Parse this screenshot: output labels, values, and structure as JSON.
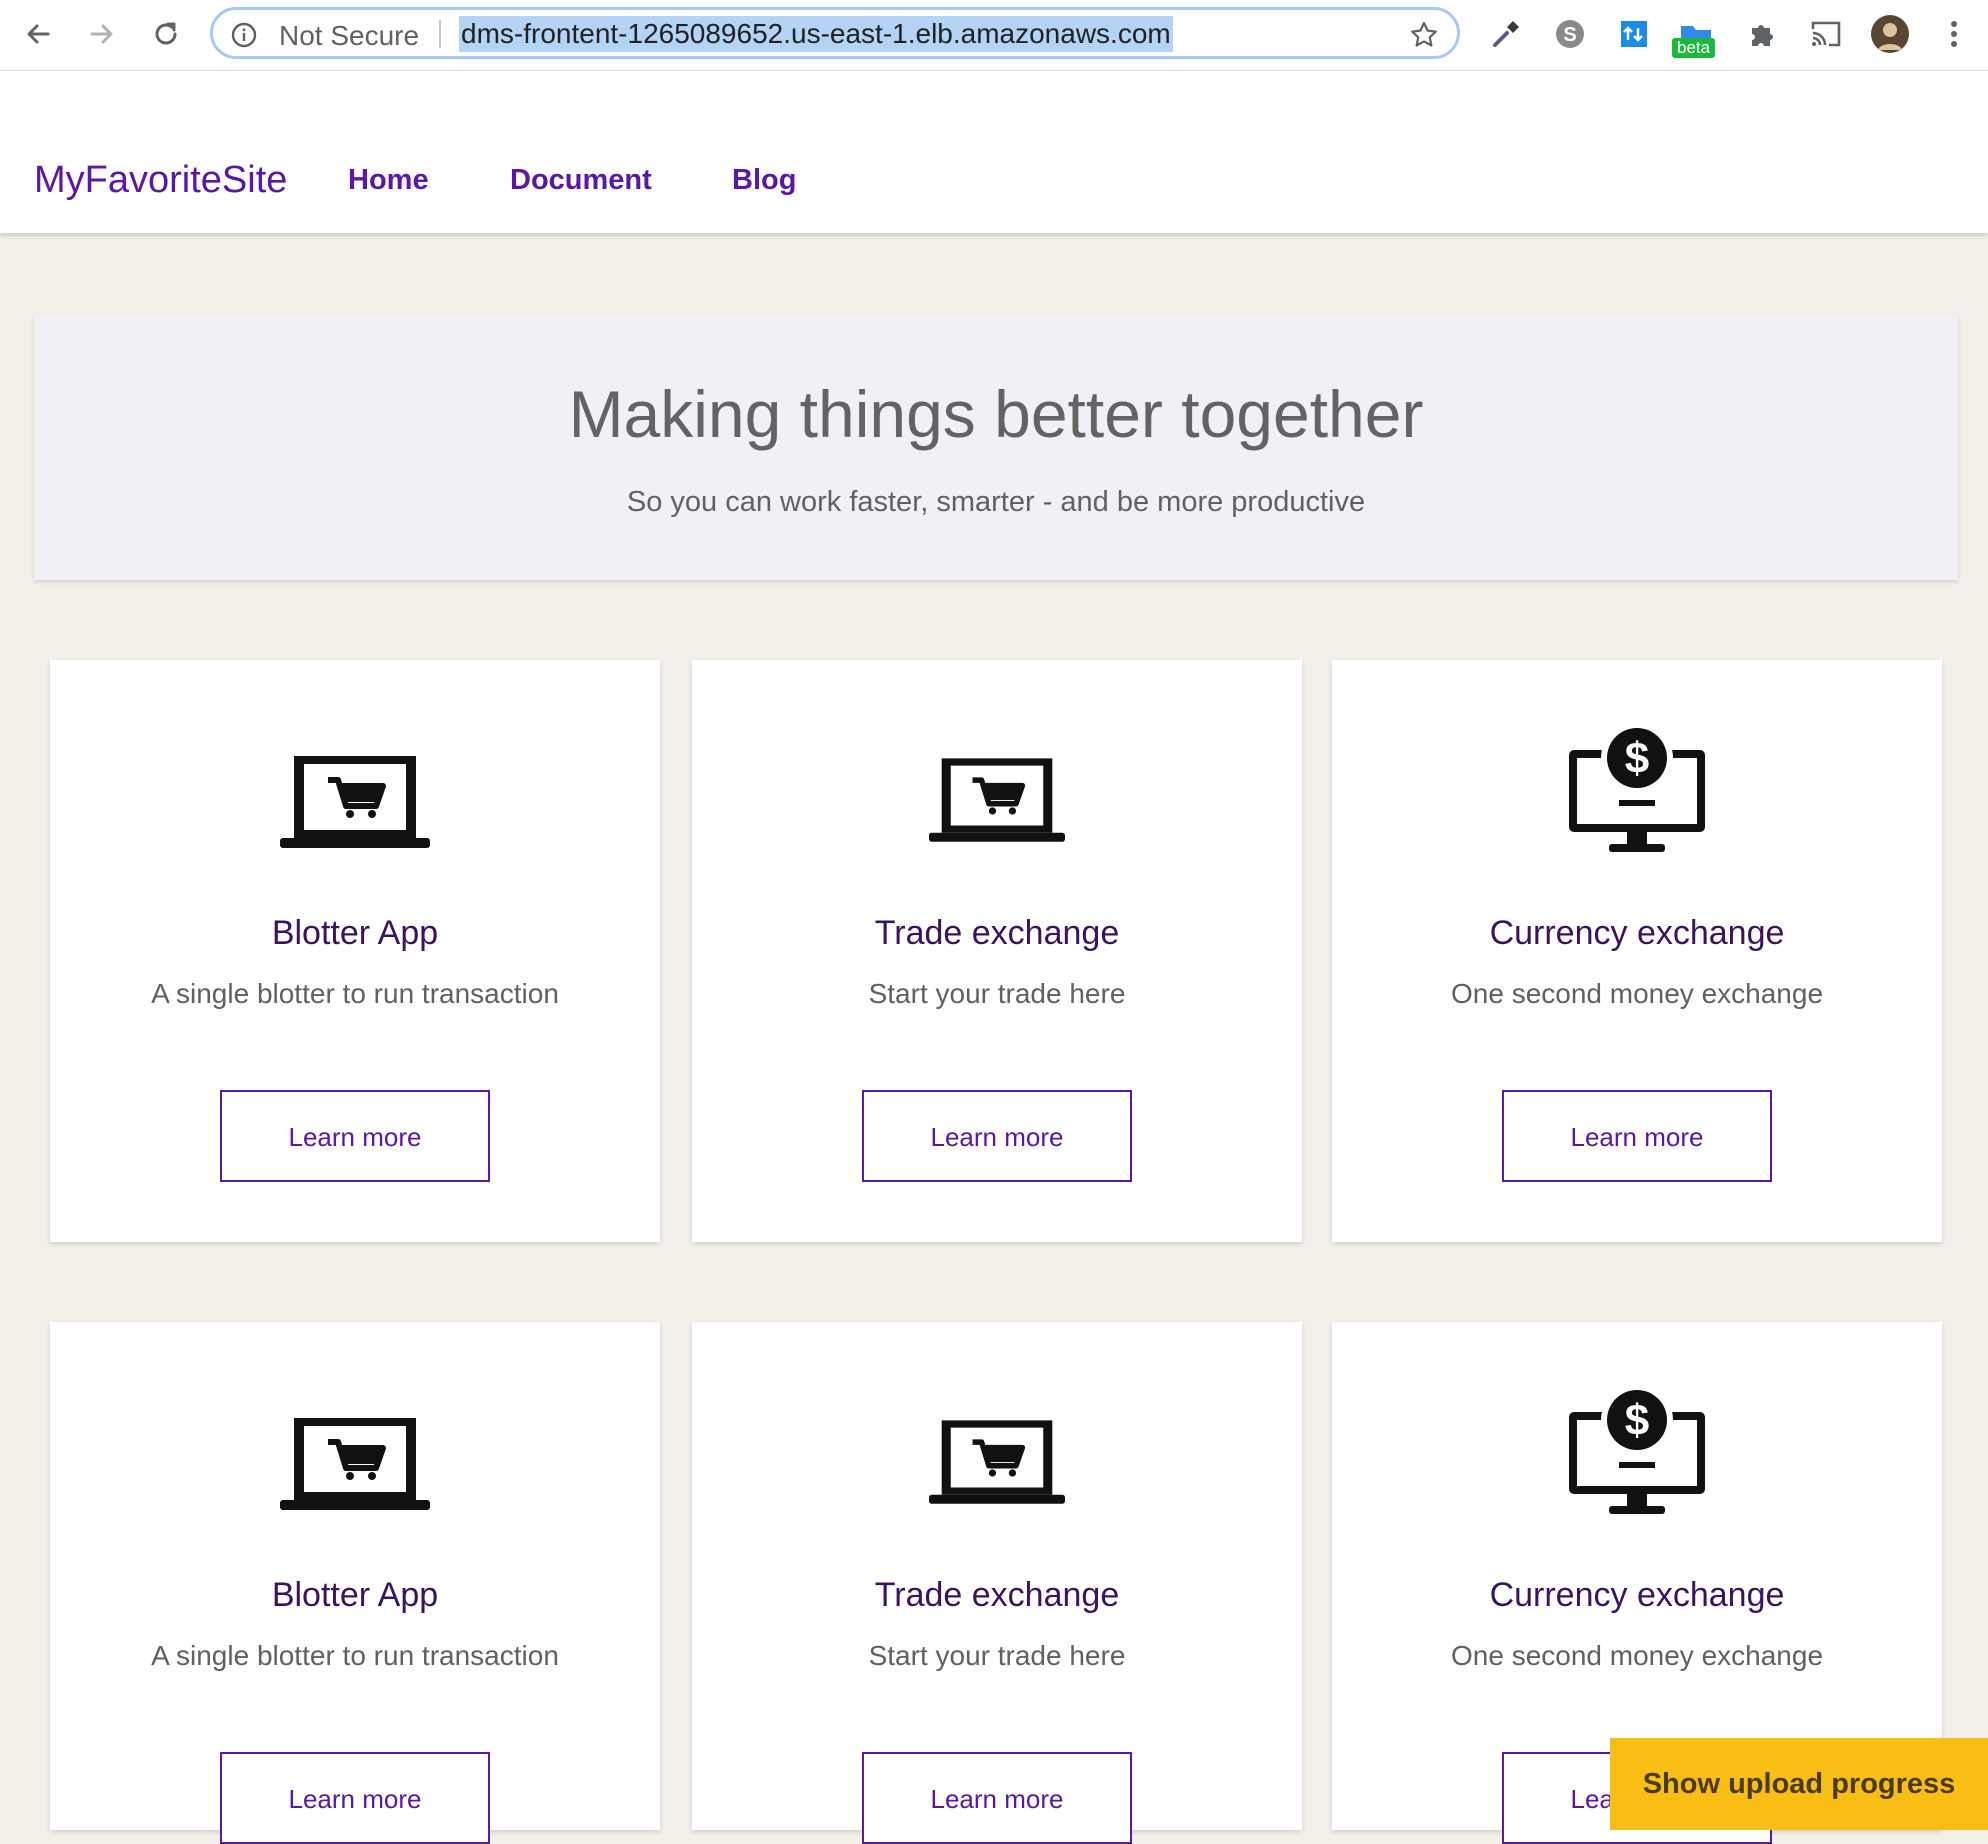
{
  "browser": {
    "security_label": "Not Secure",
    "url": "dms-frontent-1265089652.us-east-1.elb.amazonaws.com",
    "extension_badge": "beta"
  },
  "site": {
    "brand": "MyFavoriteSite",
    "nav": [
      {
        "label": "Home"
      },
      {
        "label": "Document"
      },
      {
        "label": "Blog"
      }
    ]
  },
  "hero": {
    "title": "Making things better together",
    "subtitle": "So you can work faster, smarter - and be more productive"
  },
  "cards": [
    {
      "icon": "laptop-cart-icon",
      "title": "Blotter App",
      "description": "A single blotter to run transaction",
      "button": "Learn more"
    },
    {
      "icon": "laptop-cart-icon",
      "title": "Trade exchange",
      "description": "Start your trade here",
      "button": "Learn more"
    },
    {
      "icon": "monitor-dollar-icon",
      "title": "Currency exchange",
      "description": "One second money exchange",
      "button": "Learn more"
    },
    {
      "icon": "laptop-cart-icon",
      "title": "Blotter App",
      "description": "A single blotter to run transaction",
      "button": "Learn more"
    },
    {
      "icon": "laptop-cart-icon",
      "title": "Trade exchange",
      "description": "Start your trade here",
      "button": "Learn more"
    },
    {
      "icon": "monitor-dollar-icon",
      "title": "Currency exchange",
      "description": "One second money exchange",
      "button": "Learn more"
    }
  ],
  "upload": {
    "label": "Show upload progress"
  },
  "colors": {
    "accent": "#5b17a8",
    "title": "#3c1361",
    "upload_bg": "#f9be14",
    "page_bg": "#f3efe9"
  }
}
